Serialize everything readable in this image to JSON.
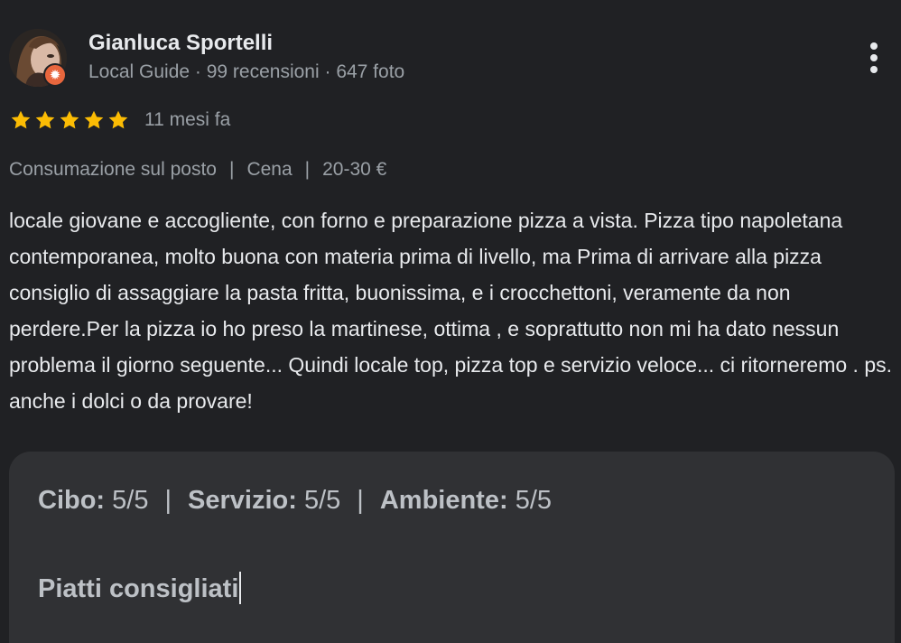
{
  "author": {
    "name": "Gianluca Sportelli",
    "meta": "Local Guide · 99 recensioni · 647 foto"
  },
  "review": {
    "rating": 5,
    "rating_max": 5,
    "time": "11 mesi fa",
    "details": [
      "Consumazione sul posto",
      "Cena",
      "20-30 €"
    ],
    "text": "locale giovane e accogliente, con forno e preparazione pizza a vista. Pizza tipo napoletana contemporanea, molto buona con materia prima di livello, ma Prima di arrivare alla pizza consiglio di assaggiare la pasta fritta, buonissima, e i crocchettoni, veramente da non perdere.Per la pizza io ho preso la martinese, ottima , e soprattutto non mi ha dato nessun problema il giorno seguente... Quindi locale top, pizza top e servizio veloce... ci ritorneremo . ps. anche i dolci o da provare!"
  },
  "attributes": {
    "cibo_label": "Cibo:",
    "cibo_value": "5/5",
    "servizio_label": "Servizio:",
    "servizio_value": "5/5",
    "ambiente_label": "Ambiente:",
    "ambiente_value": "5/5",
    "separator": "|"
  },
  "dishes": {
    "title": "Piatti consigliati"
  },
  "colors": {
    "background": "#202124",
    "panel": "#303134",
    "star": "#fbbc04",
    "badge": "#e8663d"
  },
  "icons": {
    "badge": "local-guide-star-icon",
    "menu": "more-vertical-icon",
    "star": "star-icon"
  }
}
